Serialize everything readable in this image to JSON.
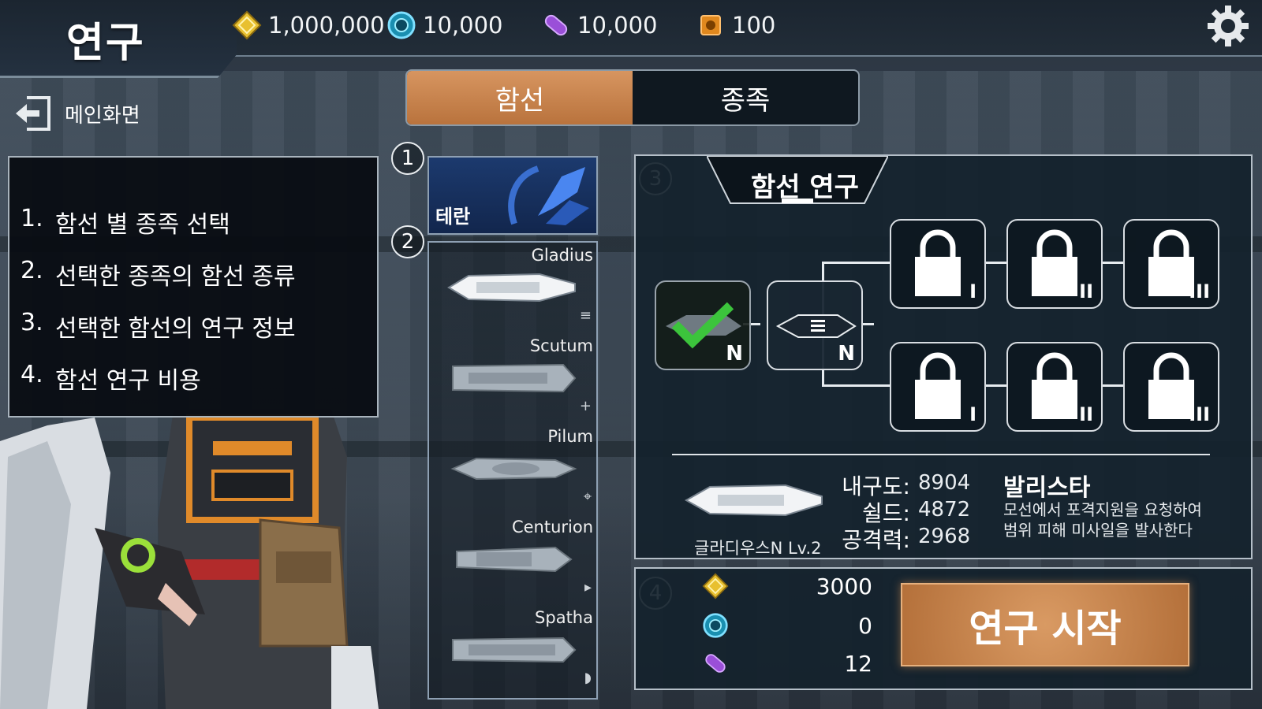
{
  "header": {
    "title": "연구",
    "resources": [
      {
        "icon": "gold-diamond-icon",
        "value": "1,000,000"
      },
      {
        "icon": "blue-orb-icon",
        "value": "10,000"
      },
      {
        "icon": "purple-capsule-icon",
        "value": "10,000"
      },
      {
        "icon": "orange-chip-icon",
        "value": "100"
      }
    ],
    "settings_icon": "gear-icon"
  },
  "nav": {
    "back_label": "메인화면"
  },
  "tabs": [
    {
      "label": "함선",
      "active": true
    },
    {
      "label": "종족",
      "active": false
    }
  ],
  "guide": {
    "items": [
      {
        "num": "1.",
        "text": "함선 별 종족 선택"
      },
      {
        "num": "2.",
        "text": "선택한 종족의 함선 종류"
      },
      {
        "num": "3.",
        "text": "선택한 함선의 연구 정보"
      },
      {
        "num": "4.",
        "text": "함선 연구 비용"
      }
    ]
  },
  "markers": [
    "1",
    "2",
    "3",
    "4"
  ],
  "race": {
    "label": "테란"
  },
  "ships": [
    {
      "name": "Gladius",
      "mini": "≡"
    },
    {
      "name": "Scutum",
      "mini": "+"
    },
    {
      "name": "Pilum",
      "mini": "⌖"
    },
    {
      "name": "Centurion",
      "mini": "▸"
    },
    {
      "name": "Spatha",
      "mini": "◗"
    }
  ],
  "research": {
    "title": "함선 연구",
    "nodes": {
      "done_grade": "N",
      "current_grade": "N",
      "locked_tiers_top": [
        "I",
        "II",
        "III"
      ],
      "locked_tiers_bottom": [
        "I",
        "II",
        "III"
      ]
    },
    "stats": [
      {
        "label": "내구도:",
        "value": "8904"
      },
      {
        "label": "쉴드:",
        "value": "4872"
      },
      {
        "label": "공격력:",
        "value": "2968"
      }
    ],
    "ship_label": "글라디우스N Lv.2",
    "skill_name": "발리스타",
    "skill_desc_1": "모선에서 포격지원을 요청하여",
    "skill_desc_2": "범위 피해 미사일을 발사한다"
  },
  "cost": {
    "items": [
      {
        "icon": "gold-diamond-icon",
        "value": "3000"
      },
      {
        "icon": "blue-orb-icon",
        "value": "0"
      },
      {
        "icon": "purple-capsule-icon",
        "value": "12"
      }
    ],
    "start_label": "연구 시작"
  },
  "colors": {
    "accent_orange": "#c98248",
    "panel_bg": "#142230",
    "check_green": "#3cc43c"
  }
}
